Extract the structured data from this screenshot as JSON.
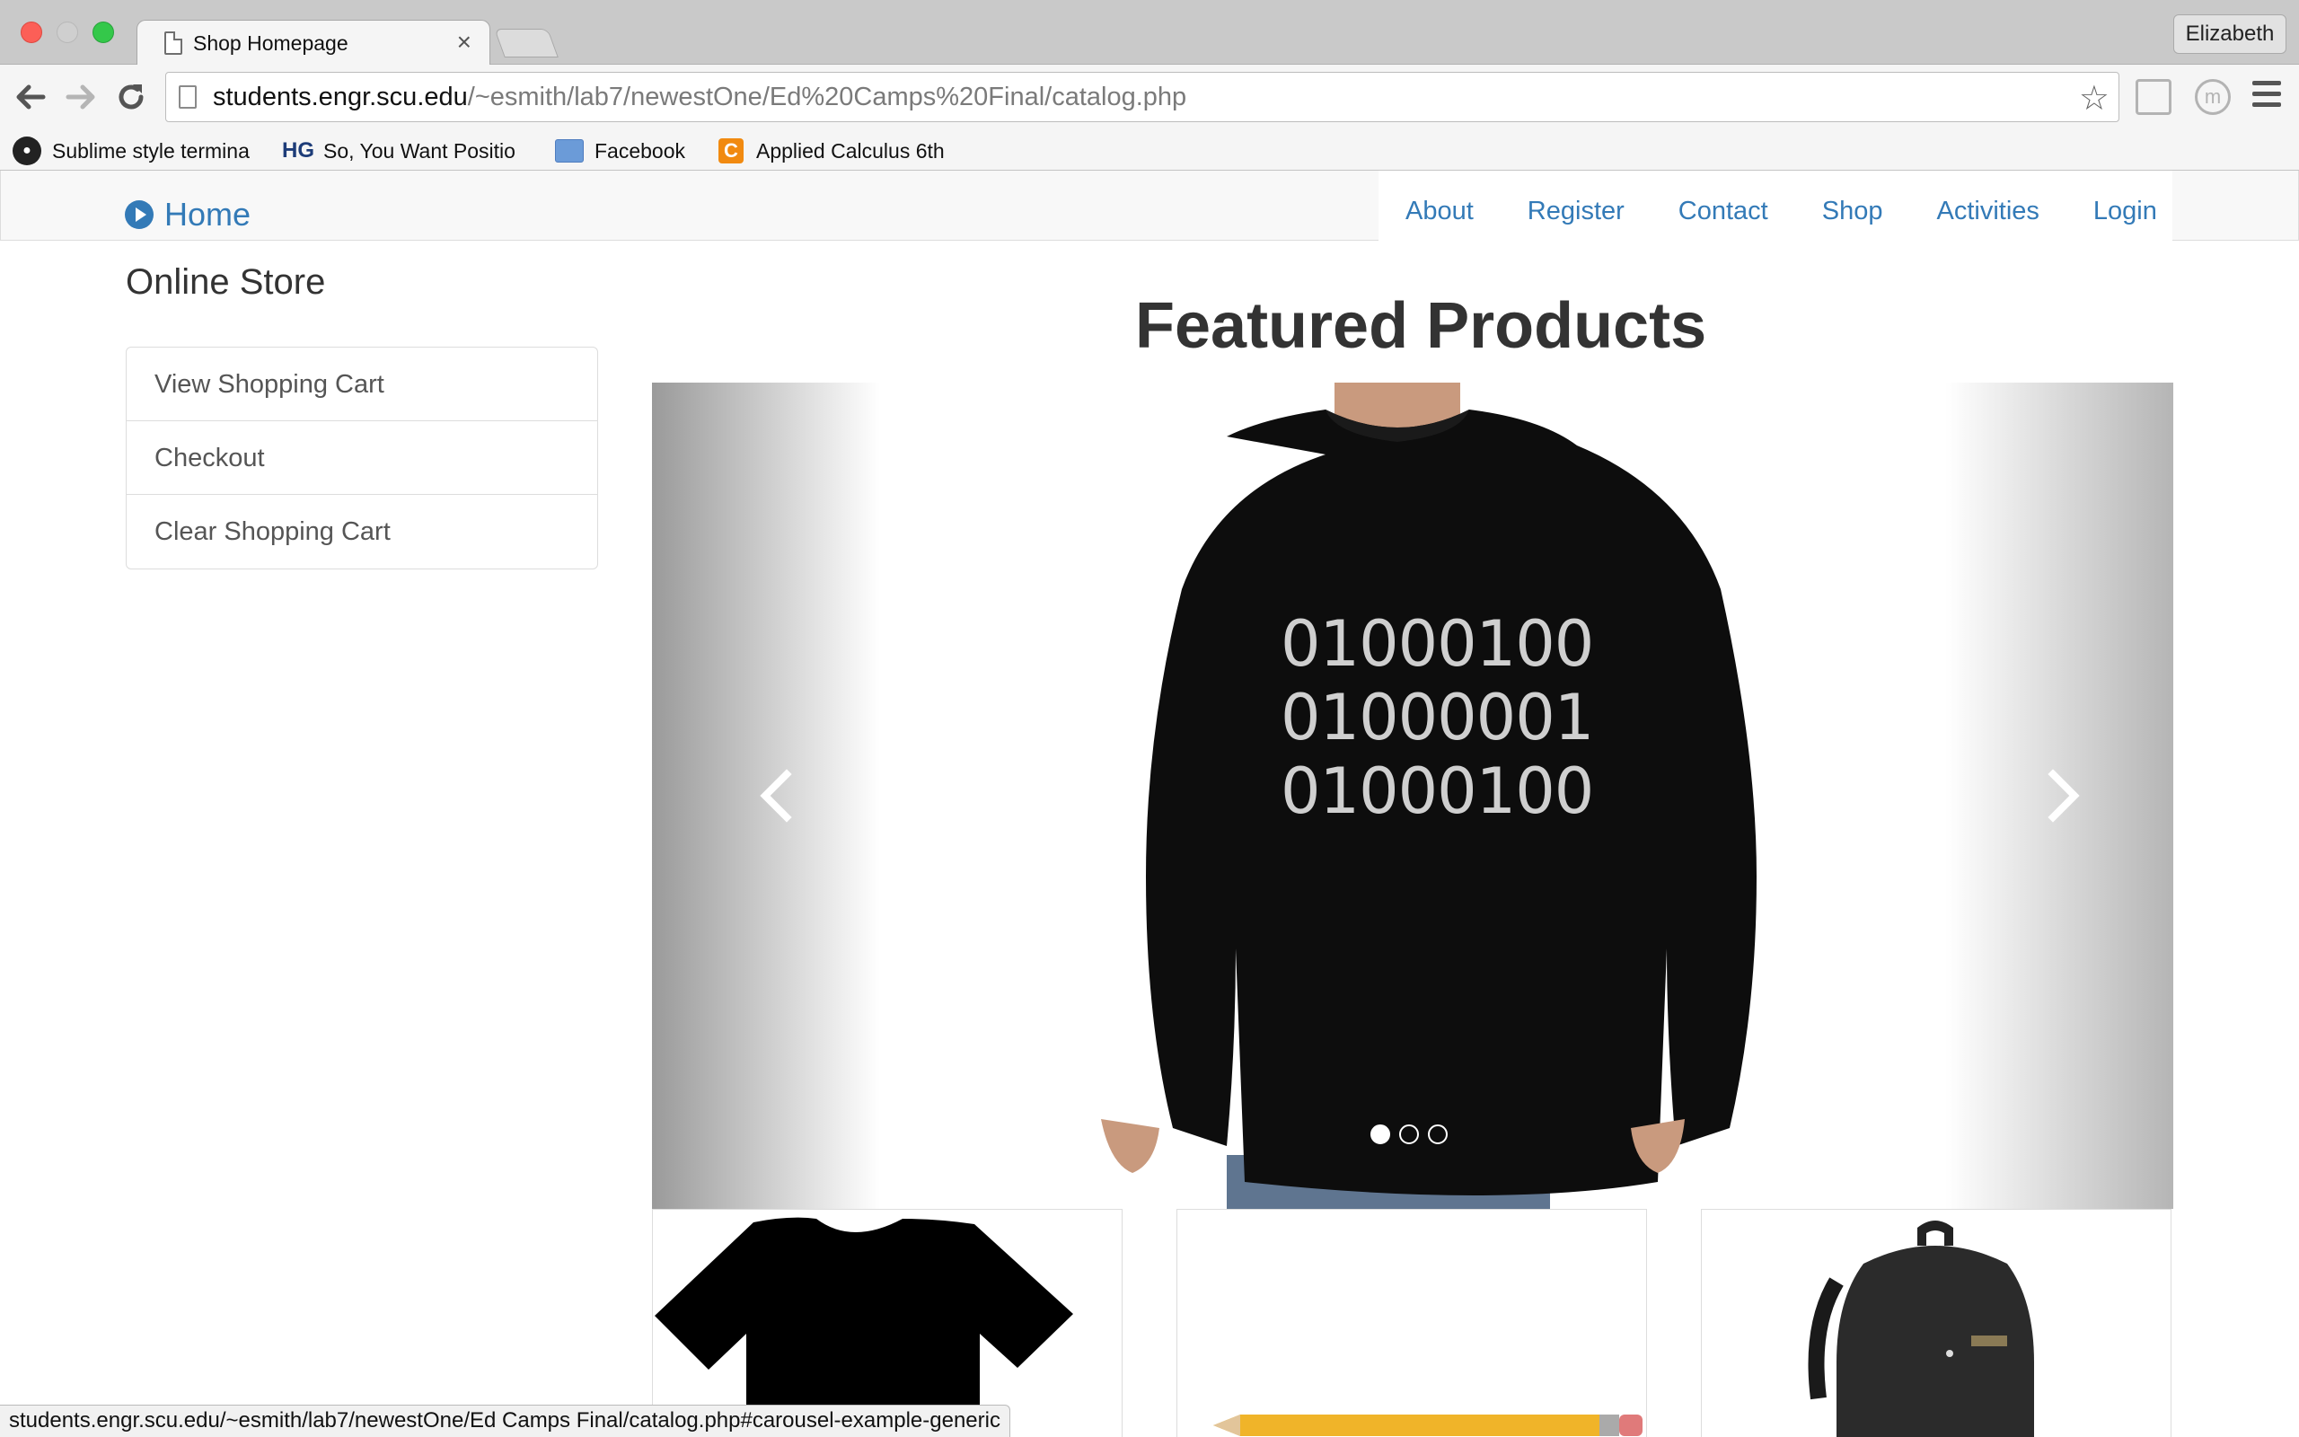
{
  "browser": {
    "tab_title": "Shop Homepage",
    "tab_close": "×",
    "profile_name": "Elizabeth",
    "url_host": "students.engr.scu.edu",
    "url_path": "/~esmith/lab7/newestOne/Ed%20Camps%20Final/catalog.php",
    "bookmarks": [
      {
        "label": "Sublime style termina",
        "icon": "github-icon"
      },
      {
        "label": "So, You Want Positio",
        "icon": "hg-icon"
      },
      {
        "label": "Facebook",
        "icon": "folder-icon"
      },
      {
        "label": "Applied Calculus 6th",
        "icon": "chegg-icon"
      }
    ],
    "status_url": "students.engr.scu.edu/~esmith/lab7/newestOne/Ed Camps Final/catalog.php#carousel-example-generic"
  },
  "navbar": {
    "brand": "Home",
    "links": [
      "About",
      "Register",
      "Contact",
      "Shop",
      "Activities",
      "Login"
    ]
  },
  "sidebar": {
    "title": "Online Store",
    "items": [
      "View Shopping Cart",
      "Checkout",
      "Clear Shopping Cart"
    ]
  },
  "main": {
    "heading": "Featured Products",
    "carousel": {
      "binary_lines": [
        "01000100",
        "01000001",
        "01000100"
      ],
      "slide_count": 3,
      "active_index": 0
    }
  }
}
